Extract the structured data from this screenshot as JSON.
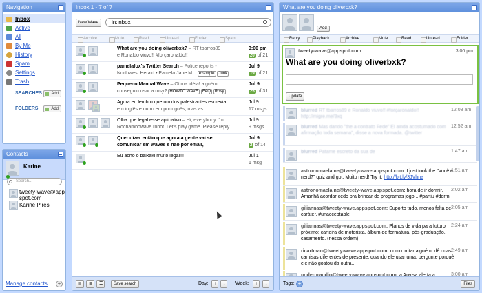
{
  "nav": {
    "title": "Navigation",
    "items": [
      {
        "label": "Inbox",
        "color": "#e8b84a"
      },
      {
        "label": "Active",
        "color": "#4fa34a"
      },
      {
        "label": "All",
        "color": "#5b89d9"
      },
      {
        "label": "By Me",
        "color": "#e08a3c"
      },
      {
        "label": "History",
        "color": "#d6a43e"
      },
      {
        "label": "Spam",
        "color": "#c33"
      },
      {
        "label": "Settings",
        "color": "#888"
      },
      {
        "label": "Trash",
        "color": "#777"
      }
    ],
    "searches_label": "SEARCHES",
    "folders_label": "FOLDERS",
    "add_label": "Add"
  },
  "contacts": {
    "title": "Contacts",
    "me": "Karine",
    "search_placeholder": "Search...",
    "list": [
      {
        "name": "tweety-wave@appspot.com"
      },
      {
        "name": "Karine Pires"
      }
    ],
    "manage": "Manage contacts"
  },
  "inbox": {
    "title": "Inbox 1 - 7 of 7",
    "new_wave": "New Wave",
    "query": "in:inbox",
    "toolbar": [
      "Archive",
      "Mute",
      "Read",
      "Unread",
      "Folder",
      "Spam"
    ],
    "rows": [
      {
        "title": "What are you doing oliverbxk?",
        "snippet": " – RT tbarros89",
        "sub": "e Ronaldo viuvo!! #forçaronaldo!!",
        "date": "3:00 pm",
        "badge": "20",
        "count": "of 21",
        "bold": true
      },
      {
        "title": "pamelafox's Twitter Search",
        "snippet": " – Police reports -",
        "sub": "Northwest Herald  • Pamela Jane M...",
        "tags": [
          "example",
          "Junk"
        ],
        "date": "Jul 9",
        "badge": "19",
        "count": "of 21",
        "bold": true
      },
      {
        "title": "Pequeno Manual Wave",
        "snippet": " – Ótima idéia! alguém",
        "sub": "conseguiu usar a rosy?",
        "tags": [
          "HOWTO WAVE",
          "FAQ",
          "Rosy"
        ],
        "date": "Jul 9",
        "badge": "25",
        "count": "of 31",
        "bold": true
      },
      {
        "title": "Agora eu lembro que um dos palestrantes escrevia",
        "snippet": "",
        "sub": "em inglês e outro em português, mas as",
        "date": "Jul 9",
        "badge": "",
        "count": "17 msgs",
        "bold": false
      },
      {
        "title": "Olha que legal esse aplicativo",
        "snippet": " – Hi, everybody I'm",
        "sub": "Rochambowave robot. Let's play game. Please reply",
        "date": "Jul 9",
        "badge": "",
        "count": "9 msgs",
        "bold": false
      },
      {
        "title": "Quer dizer então que agora a gente vai se",
        "snippet": "",
        "sub": "comunicar em waves e não por email,",
        "date": "Jul 9",
        "badge": "2",
        "count": "of 14",
        "bold": true
      },
      {
        "title": "Eu acho o baixaki muito legal!!!",
        "snippet": "",
        "sub": "",
        "date": "Jul 1",
        "badge": "",
        "count": "1 msg",
        "bold": false
      }
    ],
    "footer": {
      "save_search": "Save search",
      "day": "Day:",
      "week": "Week:"
    }
  },
  "wave": {
    "title": "What are you doing oliverbxk?",
    "add_label": "Add",
    "toolbar": [
      "Reply",
      "Playback",
      "Archive",
      "Mute",
      "Read",
      "Unread",
      "Folder"
    ],
    "root": {
      "author": "tweety-wave@appspot.com:",
      "time": "3:00 pm",
      "text": "What are you doing oliverbxk?",
      "update": "Update"
    },
    "blips": [
      {
        "author": "blurred",
        "text": "RT tbarros89 e Ronaldo viuvo!! #forçaronaldo!! http://migre.me/3xq",
        "time": "12:08 am",
        "blurred": true
      },
      {
        "author": "blurred",
        "text": "Mas dando \"the a contrato Fede\" El ainda acostumado com afirmação toda semana\", disse a nova formada. @twitter",
        "time": "12:52 am",
        "blurred": true
      },
      {
        "author": "blurred",
        "text": "Patame escreto da sua de",
        "time": "1:47 am",
        "blurred": true
      },
      {
        "author": "astronomaelaine@tweety-wave.appspot.com:",
        "text": " I just took the \"Você é nerd?\" quiz and got: Muito nerd! Try it: ",
        "link": "http://bit.ly/3JVhna",
        "time": "1:51 am",
        "blurred": false
      },
      {
        "author": "astronomaelaine@tweety-wave.appspot.com:",
        "text": " hora de ir dormir. Amanhã acordar cedo pra brincar de programas jogo... #partiu #dormi",
        "time": "2:02 am",
        "blurred": false
      },
      {
        "author": "giliannas@tweety-wave.appspot.com:",
        "text": " Suporto tudo, menos falta de caráter.  #unacceptable",
        "time": "2:05 am",
        "blurred": false
      },
      {
        "author": "giliannas@tweety-wave.appspot.com:",
        "text": " Planos de vida para futuro próximo: carteira de motorista, álbum de formatura, pós-graduação, casamento. (nessa ordem)",
        "time": "2:24 am",
        "blurred": false
      },
      {
        "author": "ricartman@tweety-wave.appspot.com:",
        "text": " como irritar alguém: dê duas camisas diferentes de presente, quando ele usar uma, pergunte porquê ele não gostou da outra...",
        "time": "2:49 am",
        "blurred": false
      },
      {
        "author": "undergraudio@tweety-wave.appspot.com:",
        "text": " a Anvisa alerta a",
        "time": "3:00 am",
        "blurred": false
      }
    ],
    "tags_label": "Tags:",
    "files_label": "Files"
  }
}
